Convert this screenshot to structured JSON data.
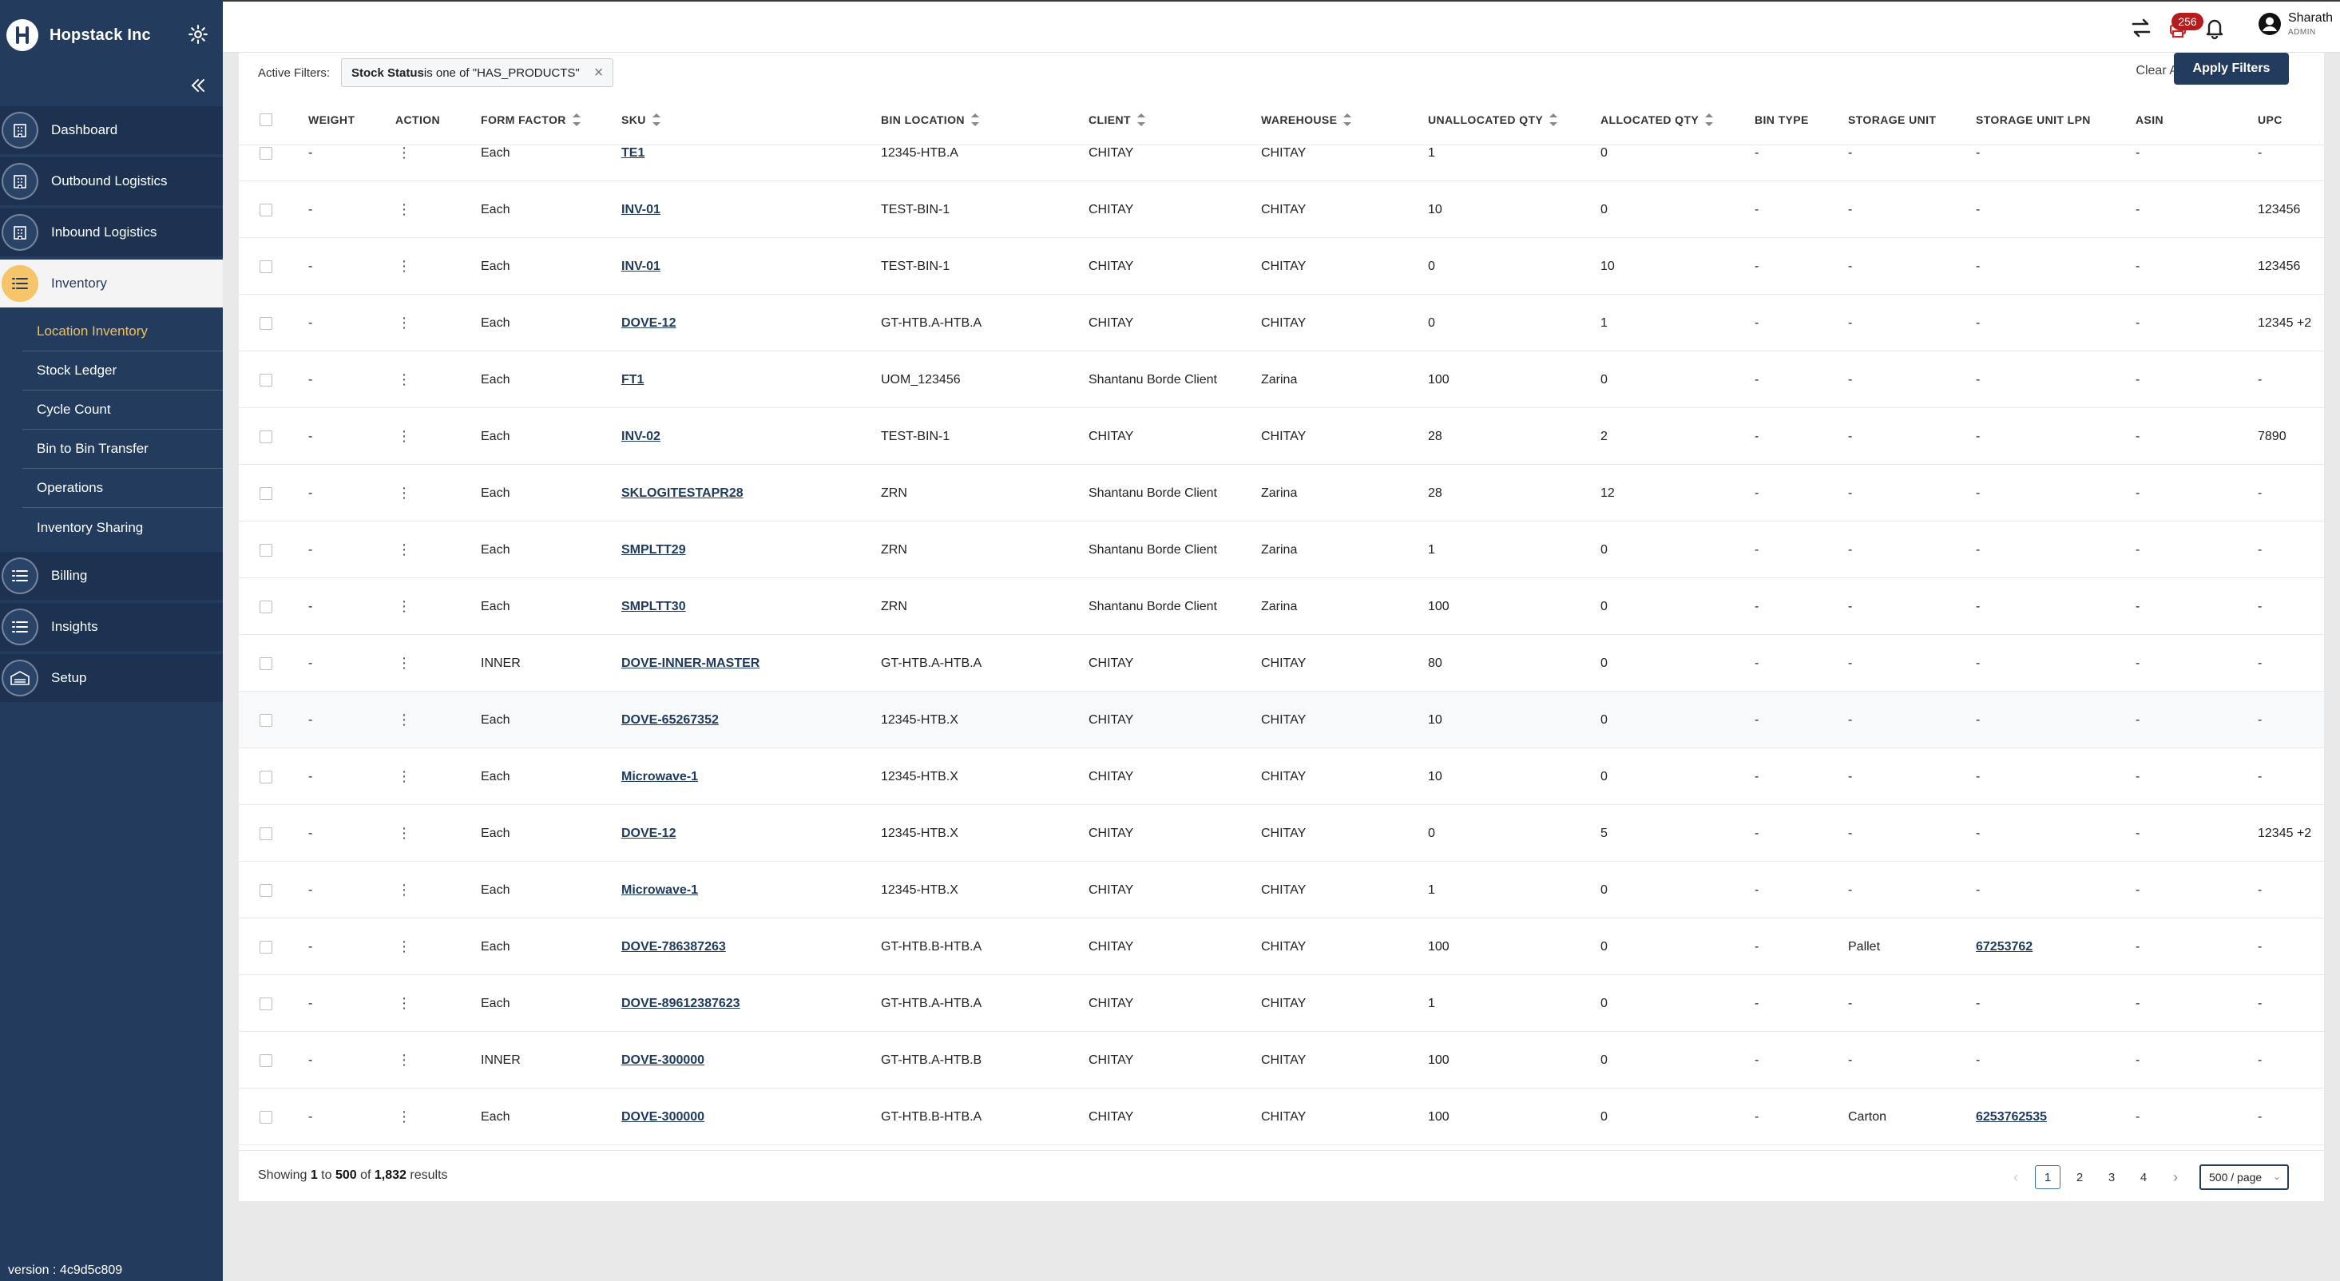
{
  "brand": {
    "name": "Hopstack Inc"
  },
  "sidebar": {
    "items": [
      {
        "label": "Dashboard",
        "icon": "building-icon"
      },
      {
        "label": "Outbound Logistics",
        "icon": "building-icon"
      },
      {
        "label": "Inbound Logistics",
        "icon": "building-icon"
      },
      {
        "label": "Inventory",
        "icon": "list-icon",
        "active": true
      },
      {
        "label": "Billing",
        "icon": "list-icon"
      },
      {
        "label": "Insights",
        "icon": "list-icon"
      },
      {
        "label": "Setup",
        "icon": "warehouse-icon"
      }
    ],
    "inventory_sub": [
      {
        "label": "Location Inventory",
        "active": true
      },
      {
        "label": "Stock Ledger"
      },
      {
        "label": "Cycle Count"
      },
      {
        "label": "Bin to Bin Transfer"
      },
      {
        "label": "Operations"
      },
      {
        "label": "Inventory Sharing"
      }
    ],
    "version": "version : 4c9d5c809"
  },
  "header": {
    "notification_count": "256",
    "user_name": "Sharath",
    "user_role": "ADMIN"
  },
  "filters": {
    "label": "Active Filters:",
    "chip_field": "Stock Status",
    "chip_rest": " is one of \"HAS_PRODUCTS\"",
    "chip_close": "×",
    "clear_all": "Clear All",
    "apply": "Apply Filters"
  },
  "table": {
    "columns": [
      "WEIGHT",
      "ACTION",
      "FORM FACTOR",
      "SKU",
      "BIN LOCATION",
      "CLIENT",
      "WAREHOUSE",
      "UNALLOCATED QTY",
      "ALLOCATED QTY",
      "BIN TYPE",
      "STORAGE UNIT",
      "STORAGE UNIT LPN",
      "ASIN",
      "UPC"
    ],
    "rows": [
      {
        "weight": "-",
        "action": "⋮",
        "form": "Each",
        "sku": "TE1",
        "bin": "12345-HTB.A",
        "client": "CHITAY",
        "warehouse": "CHITAY",
        "unalloc": "1",
        "alloc": "0",
        "bintype": "-",
        "su": "-",
        "lpn": "-",
        "asin": "-",
        "upc": "-"
      },
      {
        "weight": "-",
        "action": "⋮",
        "form": "Each",
        "sku": "INV-01",
        "bin": "TEST-BIN-1",
        "client": "CHITAY",
        "warehouse": "CHITAY",
        "unalloc": "10",
        "alloc": "0",
        "bintype": "-",
        "su": "-",
        "lpn": "-",
        "asin": "-",
        "upc": "123456"
      },
      {
        "weight": "-",
        "action": "⋮",
        "form": "Each",
        "sku": "INV-01",
        "bin": "TEST-BIN-1",
        "client": "CHITAY",
        "warehouse": "CHITAY",
        "unalloc": "0",
        "alloc": "10",
        "bintype": "-",
        "su": "-",
        "lpn": "-",
        "asin": "-",
        "upc": "123456"
      },
      {
        "weight": "-",
        "action": "⋮",
        "form": "Each",
        "sku": "DOVE-12",
        "bin": "GT-HTB.A-HTB.A",
        "client": "CHITAY",
        "warehouse": "CHITAY",
        "unalloc": "0",
        "alloc": "1",
        "bintype": "-",
        "su": "-",
        "lpn": "-",
        "asin": "-",
        "upc": "12345 +2"
      },
      {
        "weight": "-",
        "action": "⋮",
        "form": "Each",
        "sku": "FT1",
        "bin": "UOM_123456",
        "client": "Shantanu Borde Client",
        "warehouse": "Zarina",
        "unalloc": "100",
        "alloc": "0",
        "bintype": "-",
        "su": "-",
        "lpn": "-",
        "asin": "-",
        "upc": "-"
      },
      {
        "weight": "-",
        "action": "⋮",
        "form": "Each",
        "sku": "INV-02",
        "bin": "TEST-BIN-1",
        "client": "CHITAY",
        "warehouse": "CHITAY",
        "unalloc": "28",
        "alloc": "2",
        "bintype": "-",
        "su": "-",
        "lpn": "-",
        "asin": "-",
        "upc": "7890"
      },
      {
        "weight": "-",
        "action": "⋮",
        "form": "Each",
        "sku": "SKLOGITESTAPR28",
        "bin": "ZRN",
        "client": "Shantanu Borde Client",
        "warehouse": "Zarina",
        "unalloc": "28",
        "alloc": "12",
        "bintype": "-",
        "su": "-",
        "lpn": "-",
        "asin": "-",
        "upc": "-"
      },
      {
        "weight": "-",
        "action": "⋮",
        "form": "Each",
        "sku": "SMPLTT29",
        "bin": "ZRN",
        "client": "Shantanu Borde Client",
        "warehouse": "Zarina",
        "unalloc": "1",
        "alloc": "0",
        "bintype": "-",
        "su": "-",
        "lpn": "-",
        "asin": "-",
        "upc": "-"
      },
      {
        "weight": "-",
        "action": "⋮",
        "form": "Each",
        "sku": "SMPLTT30",
        "bin": "ZRN",
        "client": "Shantanu Borde Client",
        "warehouse": "Zarina",
        "unalloc": "100",
        "alloc": "0",
        "bintype": "-",
        "su": "-",
        "lpn": "-",
        "asin": "-",
        "upc": "-"
      },
      {
        "weight": "-",
        "action": "⋮",
        "form": "INNER",
        "sku": "DOVE-INNER-MASTER",
        "bin": "GT-HTB.A-HTB.A",
        "client": "CHITAY",
        "warehouse": "CHITAY",
        "unalloc": "80",
        "alloc": "0",
        "bintype": "-",
        "su": "-",
        "lpn": "-",
        "asin": "-",
        "upc": "-"
      },
      {
        "weight": "-",
        "action": "⋮",
        "form": "Each",
        "sku": "DOVE-65267352",
        "bin": "12345-HTB.X",
        "client": "CHITAY",
        "warehouse": "CHITAY",
        "unalloc": "10",
        "alloc": "0",
        "bintype": "-",
        "su": "-",
        "lpn": "-",
        "asin": "-",
        "upc": "-",
        "hl": true
      },
      {
        "weight": "-",
        "action": "⋮",
        "form": "Each",
        "sku": "Microwave-1",
        "bin": "12345-HTB.X",
        "client": "CHITAY",
        "warehouse": "CHITAY",
        "unalloc": "10",
        "alloc": "0",
        "bintype": "-",
        "su": "-",
        "lpn": "-",
        "asin": "-",
        "upc": "-"
      },
      {
        "weight": "-",
        "action": "⋮",
        "form": "Each",
        "sku": "DOVE-12",
        "bin": "12345-HTB.X",
        "client": "CHITAY",
        "warehouse": "CHITAY",
        "unalloc": "0",
        "alloc": "5",
        "bintype": "-",
        "su": "-",
        "lpn": "-",
        "asin": "-",
        "upc": "12345 +2"
      },
      {
        "weight": "-",
        "action": "⋮",
        "form": "Each",
        "sku": "Microwave-1",
        "bin": "12345-HTB.X",
        "client": "CHITAY",
        "warehouse": "CHITAY",
        "unalloc": "1",
        "alloc": "0",
        "bintype": "-",
        "su": "-",
        "lpn": "-",
        "asin": "-",
        "upc": "-"
      },
      {
        "weight": "-",
        "action": "⋮",
        "form": "Each",
        "sku": "DOVE-786387263",
        "bin": "GT-HTB.B-HTB.A",
        "client": "CHITAY",
        "warehouse": "CHITAY",
        "unalloc": "100",
        "alloc": "0",
        "bintype": "-",
        "su": "Pallet",
        "lpn": "67253762",
        "asin": "-",
        "upc": "-"
      },
      {
        "weight": "-",
        "action": "⋮",
        "form": "Each",
        "sku": "DOVE-89612387623",
        "bin": "GT-HTB.A-HTB.A",
        "client": "CHITAY",
        "warehouse": "CHITAY",
        "unalloc": "1",
        "alloc": "0",
        "bintype": "-",
        "su": "-",
        "lpn": "-",
        "asin": "-",
        "upc": "-"
      },
      {
        "weight": "-",
        "action": "⋮",
        "form": "INNER",
        "sku": "DOVE-300000",
        "bin": "GT-HTB.A-HTB.B",
        "client": "CHITAY",
        "warehouse": "CHITAY",
        "unalloc": "100",
        "alloc": "0",
        "bintype": "-",
        "su": "-",
        "lpn": "-",
        "asin": "-",
        "upc": "-"
      },
      {
        "weight": "-",
        "action": "⋮",
        "form": "Each",
        "sku": "DOVE-300000",
        "bin": "GT-HTB.B-HTB.A",
        "client": "CHITAY",
        "warehouse": "CHITAY",
        "unalloc": "100",
        "alloc": "0",
        "bintype": "-",
        "su": "Carton",
        "lpn": "6253762535",
        "asin": "-",
        "upc": "-"
      }
    ]
  },
  "footer": {
    "showing_prefix": "Showing ",
    "from": "1",
    "to_word": " to ",
    "to": "500",
    "of_word": " of ",
    "total": "1,832",
    "results_word": " results",
    "pages": [
      "1",
      "2",
      "3",
      "4"
    ],
    "prev": "‹",
    "next": "›",
    "per_page": "500 / page"
  },
  "colors": {
    "sidebar": "#233b5d",
    "accent": "#f3c15b",
    "badge": "#b71c1c"
  }
}
